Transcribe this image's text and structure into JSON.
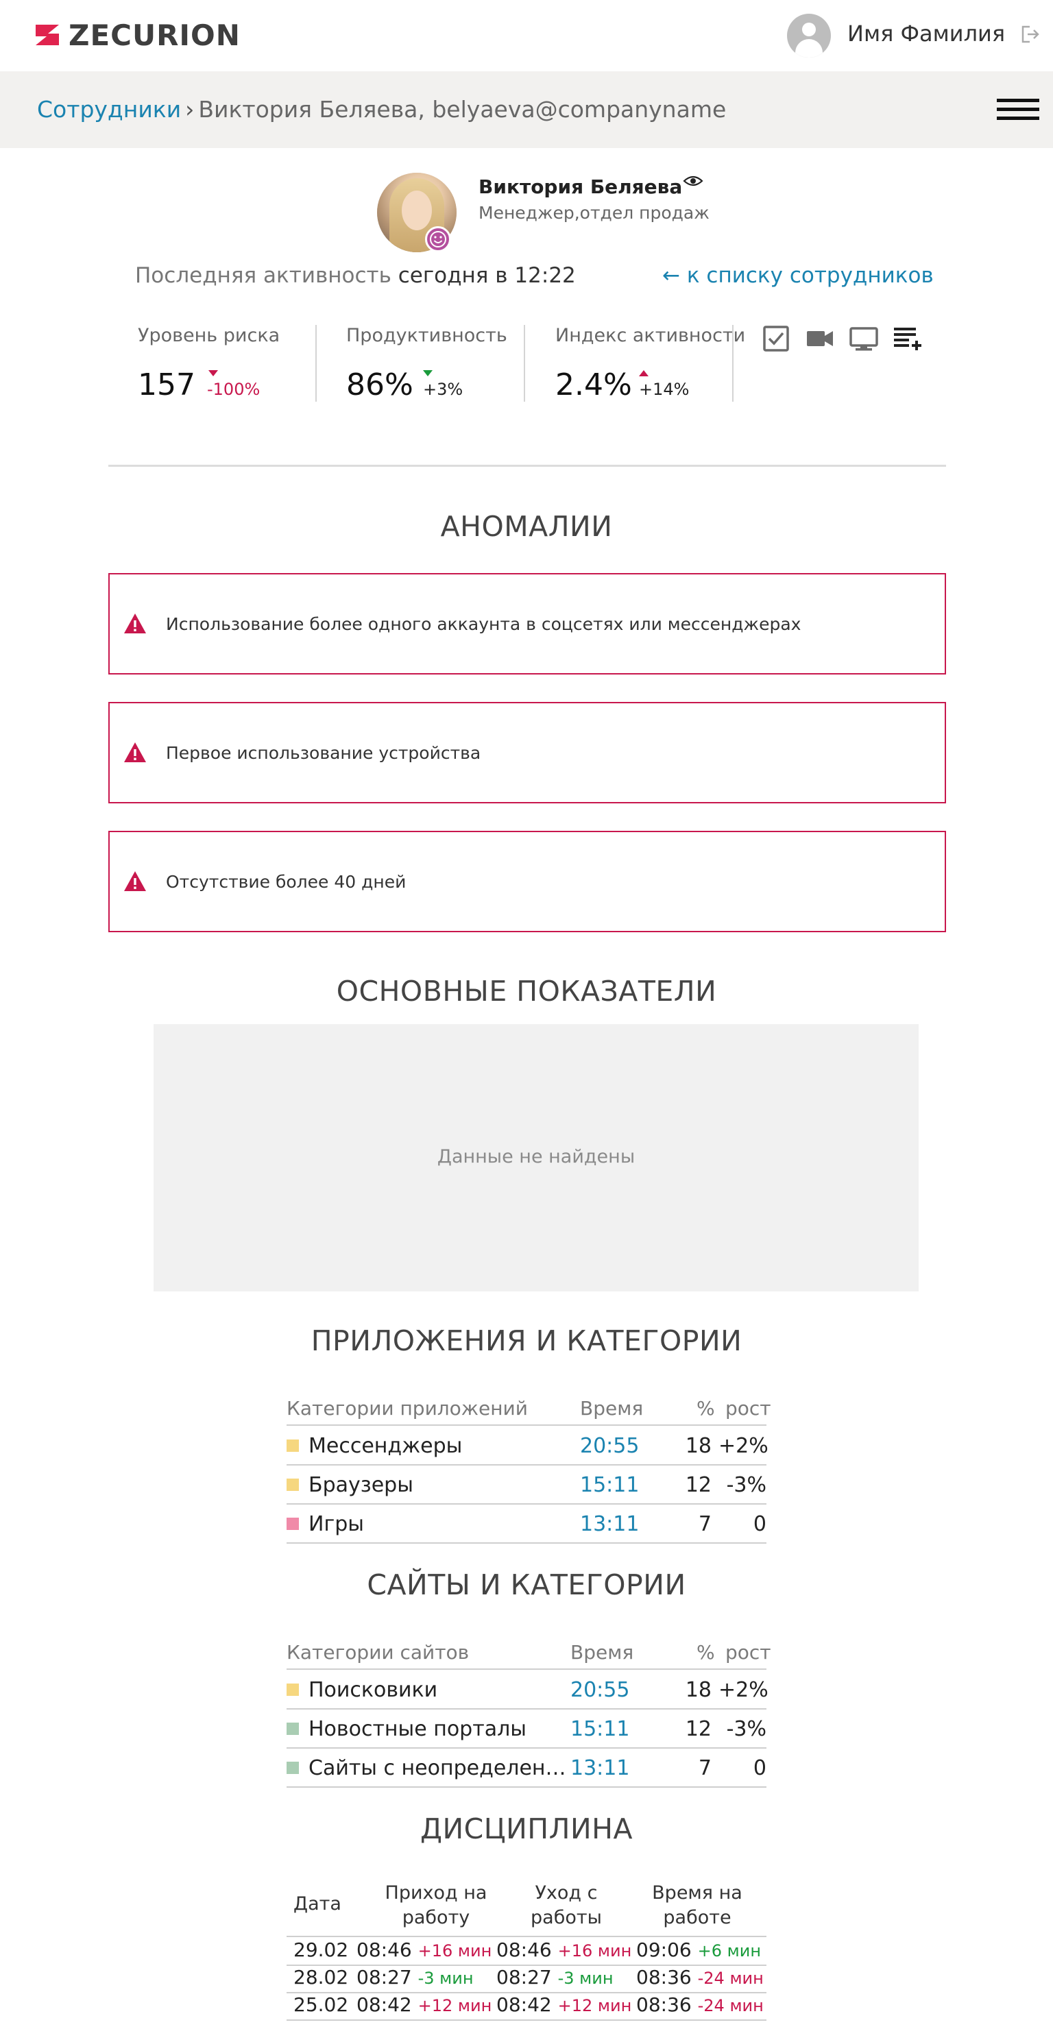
{
  "app": {
    "logo_text": "ZECURION",
    "user_name": "Имя Фамилия"
  },
  "breadcrumb": {
    "parent": "Сотрудники",
    "separator": "›",
    "current": "Виктория Беляева, belyaeva@companyname"
  },
  "profile": {
    "name": "Виктория Беляева",
    "role": "Менеджер,отдел продаж",
    "last_activity_label": "Последняя активность",
    "last_activity_value": "сегодня в 12:22",
    "back_link": "← к списку сотрудников"
  },
  "metrics": [
    {
      "label": "Уровень риска",
      "value": "157",
      "delta": "-100%",
      "trend": "down",
      "color": "#c8174d"
    },
    {
      "label": "Продуктивность",
      "value": "86%",
      "delta": "+3%",
      "trend": "down",
      "color": "#1a9b3c"
    },
    {
      "label": "Индекс активности",
      "value": "2.4%",
      "delta": "+14%",
      "trend": "up",
      "color": "#c8174d"
    }
  ],
  "toolbar_icons": [
    "checkbox-icon",
    "video-camera-icon",
    "monitor-icon",
    "playlist-add-icon"
  ],
  "anomalies": {
    "title": "АНОМАЛИИ",
    "items": [
      "Использование более одного аккаунта в соцсетях или мессенджерах",
      "Первое использование устройства",
      "Отсутствие более 40 дней"
    ]
  },
  "main_metrics": {
    "title": "ОСНОВНЫЕ ПОКАЗАТЕЛИ",
    "empty_text": "Данные не найдены"
  },
  "apps": {
    "title": "ПРИЛОЖЕНИЯ И КАТЕГОРИИ",
    "headers": [
      "Категории приложений",
      "Время",
      "%",
      "рост"
    ],
    "rows": [
      {
        "name": "Мессенджеры",
        "time": "20:55",
        "percent": "18",
        "growth": "+2%",
        "color": "#f6d77f"
      },
      {
        "name": "Браузеры",
        "time": "15:11",
        "percent": "12",
        "growth": "-3%",
        "color": "#f6d77f"
      },
      {
        "name": "Игры",
        "time": "13:11",
        "percent": "7",
        "growth": "0",
        "color": "#f08aa8"
      }
    ]
  },
  "sites": {
    "title": "САЙТЫ И КАТЕГОРИИ",
    "headers": [
      "Категории сайтов",
      "Время",
      "%",
      "рост"
    ],
    "rows": [
      {
        "name": "Поисковики",
        "time": "20:55",
        "percent": "18",
        "growth": "+2%",
        "color": "#f6d77f"
      },
      {
        "name": "Новостные порталы",
        "time": "15:11",
        "percent": "12",
        "growth": "-3%",
        "color": "#a9cdb3"
      },
      {
        "name": "Сайты с неопределенным…",
        "time": "13:11",
        "percent": "7",
        "growth": "0",
        "color": "#a9cdb3"
      }
    ]
  },
  "discipline": {
    "title": "ДИСЦИПЛИНА",
    "headers": [
      "Дата",
      "Приход на работу",
      "Уход с работы",
      "Время на работе"
    ],
    "rows": [
      {
        "date": "29.02",
        "in": "08:46",
        "in_d": "+16 мин",
        "out": "08:46",
        "out_d": "+16 мин",
        "work": "09:06",
        "work_d": "+6 мин"
      },
      {
        "date": "28.02",
        "in": "08:27",
        "in_d": "-3 мин",
        "out": "08:27",
        "out_d": "-3 мин",
        "work": "08:36",
        "work_d": "-24 мин"
      },
      {
        "date": "25.02",
        "in": "08:42",
        "in_d": "+12 мин",
        "out": "08:42",
        "out_d": "+12 мин",
        "work": "08:36",
        "work_d": "-24 мин"
      }
    ]
  }
}
